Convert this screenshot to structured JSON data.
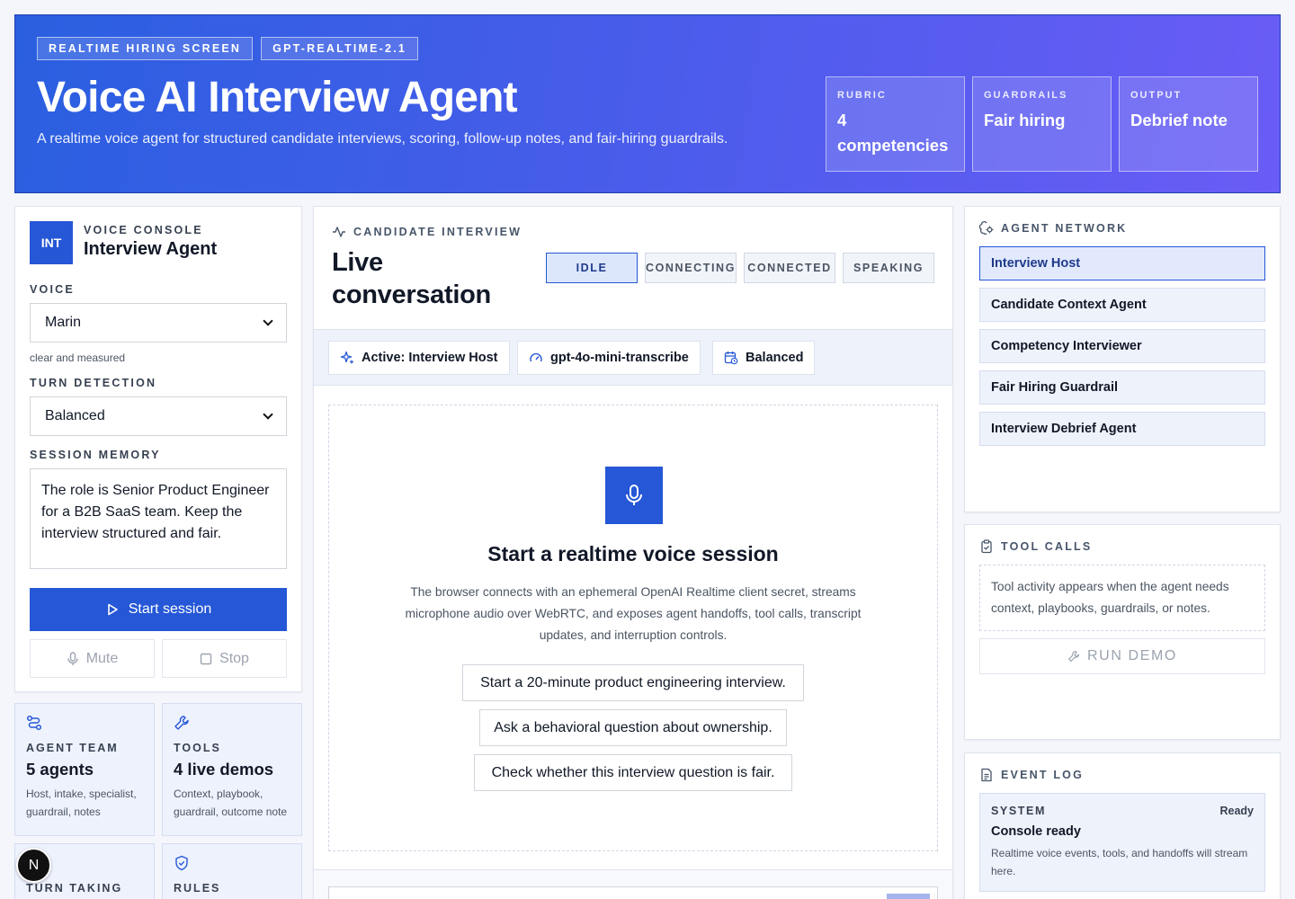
{
  "hero": {
    "chips": [
      "REALTIME HIRING SCREEN",
      "GPT-REALTIME-2.1"
    ],
    "title": "Voice AI Interview Agent",
    "description": "A realtime voice agent for structured candidate interviews, scoring, follow-up notes, and fair-hiring guardrails.",
    "stats": [
      {
        "label": "RUBRIC",
        "value": "4 competencies"
      },
      {
        "label": "GUARDRAILS",
        "value": "Fair hiring"
      },
      {
        "label": "OUTPUT",
        "value": "Debrief note"
      }
    ]
  },
  "console": {
    "badge": "INT",
    "eyebrow": "VOICE CONSOLE",
    "title": "Interview Agent",
    "voice_label": "VOICE",
    "voice_value": "Marin",
    "voice_hint": "clear and measured",
    "turn_label": "TURN DETECTION",
    "turn_value": "Balanced",
    "memory_label": "SESSION MEMORY",
    "memory_value": "The role is Senior Product Engineer for a B2B SaaS team. Keep the interview structured and fair.",
    "start_label": "Start session",
    "mute_label": "Mute",
    "stop_label": "Stop"
  },
  "mini_cards": [
    {
      "label": "AGENT TEAM",
      "value": "5 agents",
      "desc": "Host, intake, specialist, guardrail, notes"
    },
    {
      "label": "TOOLS",
      "value": "4 live demos",
      "desc": "Context, playbook, guardrail, outcome note"
    },
    {
      "label": "TURN TAKING",
      "value": "",
      "desc": ""
    },
    {
      "label": "RULES",
      "value": "",
      "desc": ""
    }
  ],
  "interview": {
    "eyebrow": "CANDIDATE INTERVIEW",
    "title": "Live conversation",
    "statuses": [
      "IDLE",
      "CONNECTING",
      "CONNECTED",
      "SPEAKING"
    ],
    "active_status": "IDLE",
    "pills": [
      "Active: Interview Host",
      "gpt-4o-mini-transcribe",
      "Balanced"
    ],
    "empty_title": "Start a realtime voice session",
    "empty_desc": "The browser connects with an ephemeral OpenAI Realtime client secret, streams microphone audio over WebRTC, and exposes agent handoffs, tool calls, transcript updates, and interruption controls.",
    "prompts": [
      "Start a 20-minute product engineering interview.",
      "Ask a behavioral question about ownership.",
      "Check whether this interview question is fair."
    ]
  },
  "agent_network": {
    "title": "AGENT NETWORK",
    "items": [
      "Interview Host",
      "Candidate Context Agent",
      "Competency Interviewer",
      "Fair Hiring Guardrail",
      "Interview Debrief Agent"
    ],
    "active": "Interview Host"
  },
  "tool_calls": {
    "title": "TOOL CALLS",
    "placeholder": "Tool activity appears when the agent needs context, playbooks, guardrails, or notes.",
    "run_label": "RUN DEMO"
  },
  "event_log": {
    "title": "EVENT LOG",
    "events": [
      {
        "source": "SYSTEM",
        "status": "Ready",
        "title": "Console ready",
        "desc": "Realtime voice events, tools, and handoffs will stream here."
      }
    ]
  },
  "colors": {
    "accent": "#2557d6",
    "hero_start": "#2a5fe0",
    "hero_end": "#6a5cf6"
  },
  "floating_badge": "N"
}
